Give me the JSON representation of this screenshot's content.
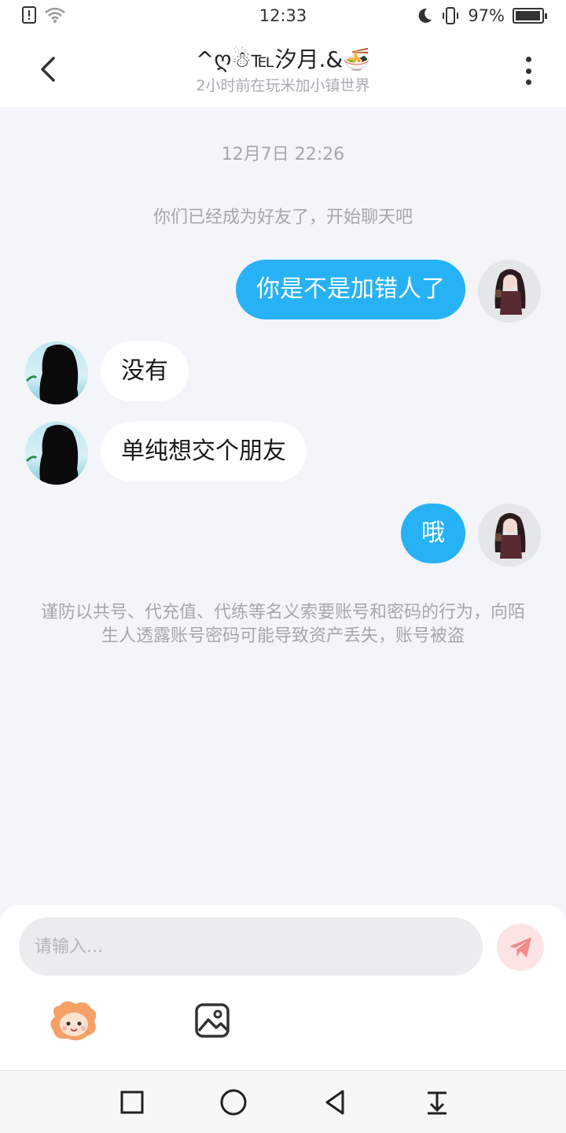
{
  "status_bar": {
    "time": "12:33",
    "battery_text": "97%",
    "battery_level": 0.97,
    "icons": [
      "alert-icon",
      "wifi-icon",
      "moon-icon",
      "vibrate-icon",
      "battery-icon"
    ]
  },
  "header": {
    "title": "^ღ☃℡汐月.&🍜",
    "subtitle": "2小时前在玩米加小镇世界"
  },
  "messages": {
    "timestamp": "12月7日 22:26",
    "system_note": "你们已经成为好友了，开始聊天吧",
    "items": [
      {
        "side": "me",
        "text": "你是不是加错人了"
      },
      {
        "side": "other",
        "text": "没有"
      },
      {
        "side": "other",
        "text": "单纯想交个朋友"
      },
      {
        "side": "me",
        "text": "哦"
      }
    ],
    "warning": "谨防以共号、代充值、代练等名义索要账号和密码的行为，向陌生人透露账号密码可能导致资产丢失，账号被盗"
  },
  "input": {
    "placeholder": "请输入..."
  },
  "colors": {
    "my_bubble": "#27b2f6",
    "other_bubble": "#ffffff",
    "background": "#f3f5f8",
    "send_button": "#fde4e4",
    "send_icon": "#f28b8b"
  }
}
